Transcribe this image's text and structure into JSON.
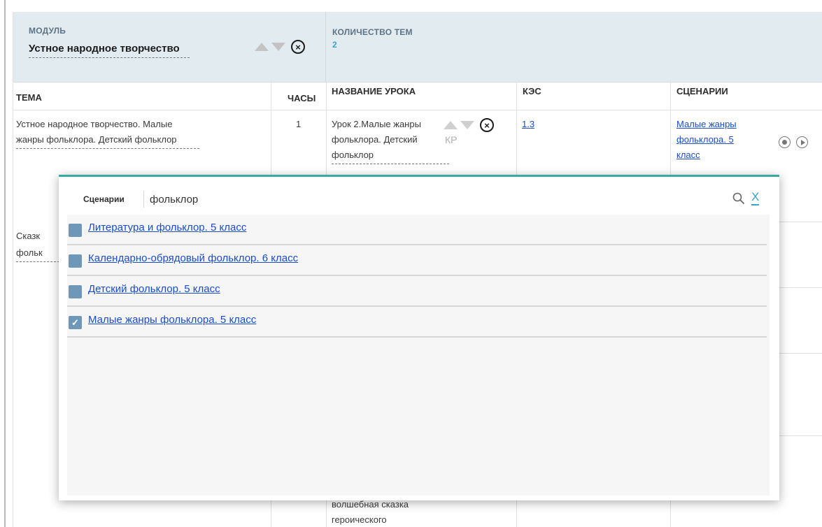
{
  "module": {
    "caption": "МОДУЛЬ",
    "name": "Устное народное творчество",
    "count_caption": "КОЛИЧЕСТВО ТЕМ",
    "count_value": "2",
    "remove_glyph": "×"
  },
  "table": {
    "headers": {
      "topic": "ТЕМА",
      "hours": "ЧАСЫ",
      "lesson": "НАЗВАНИЕ УРОКА",
      "kes": "КЭС",
      "scenarios": "СЦЕНАРИИ"
    },
    "row1": {
      "topic": "Устное народное творчество. Малые жанры фольклора. Детский фольклор",
      "hours": "1",
      "lesson": "Урок 2.Малые жанры фольклора. Детский фольклор",
      "kr": "КР",
      "kes": "1.3",
      "scenario": "Малые жанры фольклора. 5 класс"
    },
    "row2_topic_partial_a": "Сказк",
    "row2_topic_partial_b": "фольк",
    "bottom_lesson_text": "волшебная сказка героического"
  },
  "popup": {
    "tag": "Сценарии",
    "search_value": "фольклор",
    "close_label": "X",
    "check_glyph": "✓",
    "items": [
      {
        "label": "Литература и фольклор. 5 класс",
        "checked": false
      },
      {
        "label": "Календарно-обрядовый фольклор. 6 класс",
        "checked": false
      },
      {
        "label": "Детский фольклор. 5 класс",
        "checked": false
      },
      {
        "label": "Малые жанры фольклора. 5 класс",
        "checked": true
      }
    ]
  },
  "colors": {
    "accent": "#37aaa1",
    "link": "#1a4dcc",
    "module_bg": "#e2ebf0",
    "checkbox": "#6f98b8",
    "count": "#3aa3c3"
  }
}
